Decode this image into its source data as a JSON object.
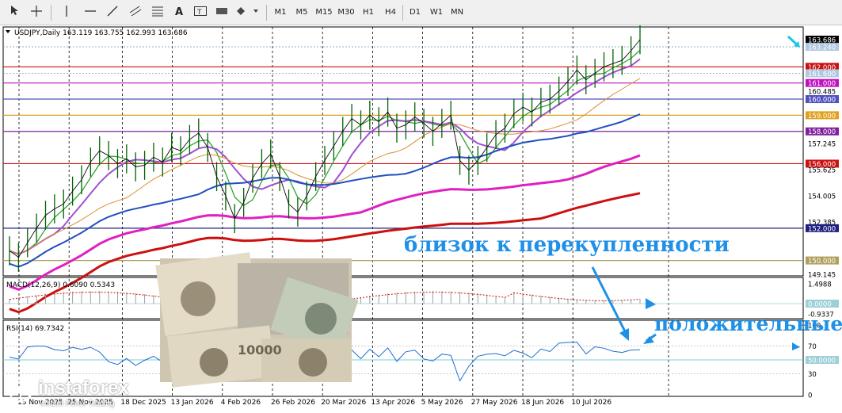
{
  "toolbar": {
    "timeframes": [
      "M1",
      "M5",
      "M15",
      "M30",
      "H1",
      "H4",
      "D1",
      "W1",
      "MN"
    ]
  },
  "main": {
    "symbol_header": "USDJPY,Daily  163.119 163.755 162.993 163.686"
  },
  "indicators": {
    "macd_label": "MACD(12,26,9) 0.6090 0.5343",
    "rsi_label": "RSI(14) 69.7342"
  },
  "annotations": {
    "overbought_text": "близок к перекупленности",
    "positive_text": "положительные"
  },
  "logo": {
    "brand": "instaforex",
    "tagline": "Instant Forex Trading"
  },
  "colors": {
    "accent_arrow": "#1e90e8",
    "price_line": "#0a7a0a",
    "ma_green": "#2ea62e",
    "ma_purple": "#a050d0",
    "ma_orange": "#d89030",
    "ma_blue": "#2050c0",
    "ma_magenta": "#e020c0",
    "ma_red": "#cc1010"
  },
  "chart_data": {
    "type": "line",
    "title": "USDJPY,Daily",
    "ohlc_last": {
      "open": 163.119,
      "high": 163.755,
      "low": 162.993,
      "close": 163.686
    },
    "x_ticks": [
      "13 Nov 2025",
      "25 Nov 2025",
      "18 Dec 2025",
      "13 Jan 2026",
      "4 Feb 2026",
      "26 Feb 2026",
      "20 Mar 2026",
      "13 Apr 2026",
      "5 May 2026",
      "27 May 2026",
      "18 Jun 2026",
      "10 Jul 2026"
    ],
    "y_ticks": [
      {
        "value": "163.686",
        "kind": "price"
      },
      {
        "value": "163.240",
        "kind": "line"
      },
      {
        "value": "162.000",
        "kind": "level",
        "color": "#cc1010"
      },
      {
        "value": "161.600",
        "kind": "line"
      },
      {
        "value": "161.000",
        "kind": "level",
        "color": "#c010c0"
      },
      {
        "value": "160.485",
        "kind": "plain"
      },
      {
        "value": "160.000",
        "kind": "level",
        "color": "#5050c0"
      },
      {
        "value": "159.000",
        "kind": "level",
        "color": "#e0a020"
      },
      {
        "value": "158.000",
        "kind": "level",
        "color": "#8020a0"
      },
      {
        "value": "157.245",
        "kind": "plain"
      },
      {
        "value": "156.000",
        "kind": "level",
        "color": "#cc1010"
      },
      {
        "value": "155.625",
        "kind": "plain"
      },
      {
        "value": "154.005",
        "kind": "plain"
      },
      {
        "value": "152.385",
        "kind": "plain"
      },
      {
        "value": "152.000",
        "kind": "level",
        "color": "#202080"
      },
      {
        "value": "150.000",
        "kind": "level",
        "color": "#b0a060"
      },
      {
        "value": "149.145",
        "kind": "plain"
      }
    ],
    "ylim": [
      149.145,
      163.686
    ],
    "close_series": [
      150.6,
      150.2,
      151.1,
      152.0,
      152.8,
      153.2,
      153.5,
      154.3,
      155.0,
      156.1,
      156.8,
      156.5,
      156.0,
      156.3,
      155.8,
      155.9,
      156.4,
      156.1,
      157.0,
      156.8,
      157.5,
      157.9,
      157.0,
      155.2,
      154.0,
      152.6,
      153.6,
      155.1,
      156.0,
      156.6,
      155.2,
      153.5,
      153.0,
      154.0,
      155.2,
      156.2,
      157.1,
      158.0,
      158.8,
      158.4,
      159.0,
      158.6,
      159.2,
      158.2,
      158.4,
      158.9,
      158.5,
      158.0,
      158.5,
      159.0,
      156.2,
      155.6,
      156.2,
      157.0,
      157.8,
      158.2,
      159.1,
      159.5,
      159.2,
      159.8,
      160.0,
      160.5,
      161.1,
      161.8,
      161.2,
      161.6,
      162.0,
      162.2,
      162.4,
      163.0,
      163.686
    ],
    "macd": {
      "label": "MACD(12,26,9)",
      "values": [
        0.609,
        0.5343
      ],
      "ticks": [
        "1.4988",
        "0.0000",
        "-0.9337"
      ]
    },
    "rsi": {
      "label": "RSI(14)",
      "value": 69.7342,
      "ticks": [
        "100",
        "70",
        "50.0000",
        "30",
        "0"
      ]
    }
  }
}
